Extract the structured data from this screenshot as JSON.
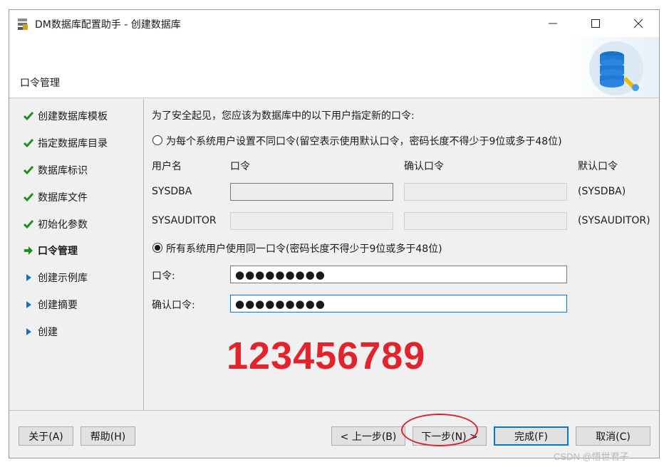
{
  "window": {
    "title": "DM数据库配置助手 - 创建数据库",
    "controls": {
      "minimize": "minimize-icon",
      "maximize": "maximize-icon",
      "close": "close-icon"
    }
  },
  "header": {
    "page_title": "口令管理"
  },
  "sidebar": {
    "steps": [
      {
        "label": "创建数据库模板",
        "status": "done"
      },
      {
        "label": "指定数据库目录",
        "status": "done"
      },
      {
        "label": "数据库标识",
        "status": "done"
      },
      {
        "label": "数据库文件",
        "status": "done"
      },
      {
        "label": "初始化参数",
        "status": "done"
      },
      {
        "label": "口令管理",
        "status": "current"
      },
      {
        "label": "创建示例库",
        "status": "pending"
      },
      {
        "label": "创建摘要",
        "status": "pending"
      },
      {
        "label": "创建",
        "status": "pending"
      }
    ]
  },
  "main": {
    "intro": "为了安全起见，您应该为数据库中的以下用户指定新的口令:",
    "option_separate": "为每个系统用户设置不同口令(留空表示使用默认口令，密码长度不得少于9位或多于48位)",
    "table_headers": {
      "username": "用户名",
      "password": "口令",
      "confirm": "确认口令",
      "default": "默认口令"
    },
    "users": [
      {
        "name": "SYSDBA",
        "default": "(SYSDBA)"
      },
      {
        "name": "SYSAUDITOR",
        "default": "(SYSAUDITOR)"
      }
    ],
    "option_same": "所有系统用户使用同一口令(密码长度不得少于9位或多于48位)",
    "password_label": "口令:",
    "password_value": "●●●●●●●●●",
    "confirm_label": "确认口令:",
    "confirm_value": "●●●●●●●●●",
    "annotation": "123456789"
  },
  "footer": {
    "about": "关于(A)",
    "help": "帮助(H)",
    "back": "< 上一步(B)",
    "next": "下一步(N) >",
    "finish": "完成(F)",
    "cancel": "取消(C)"
  },
  "watermark": "CSDN @悟世君子",
  "colors": {
    "check": "#1e8f1e",
    "arrow": "#1a6fc4",
    "annotation": "#e4222c",
    "focus": "#0078d7"
  }
}
